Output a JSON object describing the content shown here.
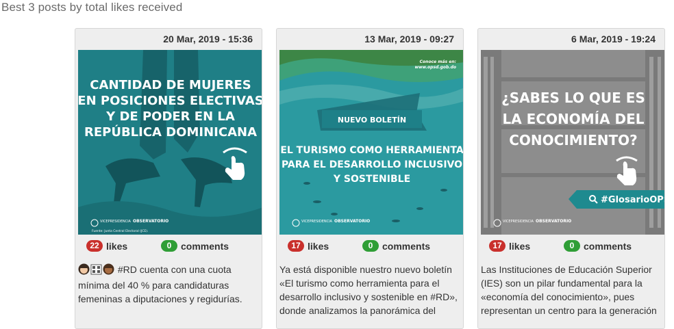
{
  "section_title": "Best 3 posts by total likes received",
  "likes_label": "likes",
  "comments_label": "comments",
  "posts": [
    {
      "date": "20 Mar, 2019 - 15:36",
      "likes": "22",
      "comments": "0",
      "text": "#RD cuenta con una cuota mínima del 40 % para candidaturas femeninas a diputaciones y regidurías.",
      "image": {
        "headline": [
          "CANTIDAD DE MUJERES",
          "EN POSICIONES ELECTIVAS",
          "Y DE PODER EN LA",
          "REPÚBLICA DOMINICANA"
        ],
        "footer_logo_left": "VICEPRESIDENCIA",
        "footer_logo_right": "OBSERVATORIO",
        "source": "Fuente: Junta Central Electoral (JCE).",
        "bg_color": "#1f7f86"
      }
    },
    {
      "date": "13 Mar, 2019 - 09:27",
      "likes": "17",
      "comments": "0",
      "text": "Ya está disponible nuestro nuevo boletín «El turismo como herramienta para el desarrollo inclusivo y sostenible en #RD», donde analizamos la panorámica del",
      "image": {
        "corner_text": [
          "Conoce más en:",
          "www.opsd.gob.do"
        ],
        "banner": "NUEVO BOLETÍN",
        "headline": [
          "EL TURISMO COMO HERRAMIENTA",
          "PARA EL DESARROLLO INCLUSIVO",
          "Y SOSTENIBLE"
        ],
        "footer_logo_left": "VICEPRESIDENCIA",
        "footer_logo_right": "OBSERVATORIO",
        "bg_color": "#2b9aa0"
      }
    },
    {
      "date": "6 Mar, 2019 - 19:24",
      "likes": "17",
      "comments": "0",
      "text": "Las Instituciones de Educación Superior (IES) son un pilar fundamental para la «economía del conocimiento», pues representan un centro para la generación",
      "image": {
        "headline": [
          "¿SABES LO QUE ES",
          "LA ECONOMÍA DEL",
          "CONOCIMIENTO?"
        ],
        "tag": "#GlosarioOPSD",
        "footer_logo_left": "VICEPRESIDENCIA",
        "footer_logo_right": "OBSERVATORIO",
        "bg_color": "#8d8d8d",
        "accent": "#1e8a8f"
      }
    }
  ]
}
